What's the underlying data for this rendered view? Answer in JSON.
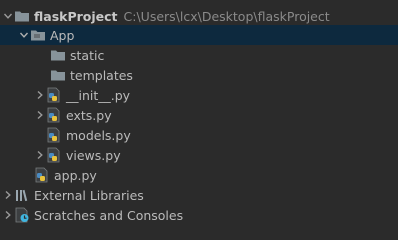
{
  "tree": {
    "root": {
      "label": "flaskProject",
      "path": "C:\\Users\\lcx\\Desktop\\flaskProject"
    },
    "app_folder": {
      "label": "App"
    },
    "items": [
      {
        "label": "static"
      },
      {
        "label": "templates"
      },
      {
        "label": "__init__.py"
      },
      {
        "label": "exts.py"
      },
      {
        "label": "models.py"
      },
      {
        "label": "views.py"
      }
    ],
    "app_py": {
      "label": "app.py"
    },
    "external_libraries": {
      "label": "External Libraries"
    },
    "scratches": {
      "label": "Scratches and Consoles"
    }
  },
  "colors": {
    "background": "#2b2b2b",
    "selection": "#0d293e",
    "folder": "#87939a",
    "python_blue": "#4a8bc2",
    "python_yellow": "#e8c23c"
  },
  "icons": {
    "expanded": "chevron-down-icon",
    "collapsed": "chevron-right-icon",
    "folder": "folder-icon",
    "python_file": "python-file-icon",
    "libraries": "libraries-icon",
    "scratches": "scratches-icon"
  }
}
